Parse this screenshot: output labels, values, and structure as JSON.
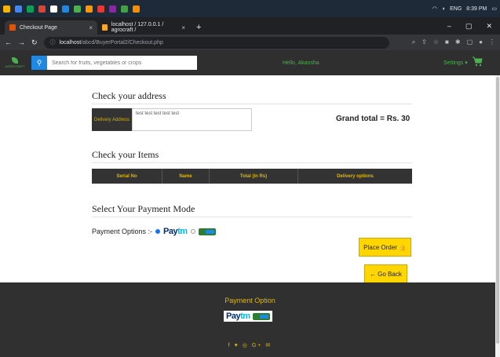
{
  "taskbar": {
    "icons": [
      "#f4b400",
      "#4285f4",
      "#0f9d58",
      "#db4437",
      "#ffffff",
      "#1e88e5",
      "#4caf50",
      "#ff9800",
      "#e53935",
      "#8e24aa",
      "#43a047",
      "#fb8c00"
    ],
    "lang": "ENG",
    "time": "8:39 PM"
  },
  "browser": {
    "tabs": [
      {
        "title": "Checkout Page",
        "color": "#e65100"
      },
      {
        "title": "localhost / 127.0.0.1 / agrocraft /",
        "color": "#f9a825"
      }
    ],
    "new_tab": "+",
    "url_host": "localhost",
    "url_path": "/abcd/BuyerPortal2/Checkout.php"
  },
  "site": {
    "logo_text": "AGROCRAFT",
    "search_placeholder": "Search for fruits, vegetables or crops",
    "greeting": "Hello, Akansha",
    "settings_label": "Settings ▾"
  },
  "checkout": {
    "address_title": "Check your address",
    "address_label": "Delivery Address",
    "address_value": "test test test test test",
    "grand_total": "Grand total = Rs. 30",
    "items_title": "Check your Items",
    "columns": [
      "Serial No",
      "Name",
      "Total (in Rs)",
      "Delivery options"
    ],
    "payment_title": "Select Your Payment Mode",
    "payment_label": "Payment Options :-",
    "paytm_p1": "Pay",
    "paytm_p2": "tm",
    "place_order": "Place Order",
    "go_back": "Go Back"
  },
  "footer": {
    "title": "Payment Option",
    "paytm_p1": "Pay",
    "paytm_p2": "tm",
    "social": "f ♥ ◎ G+ ✉"
  }
}
